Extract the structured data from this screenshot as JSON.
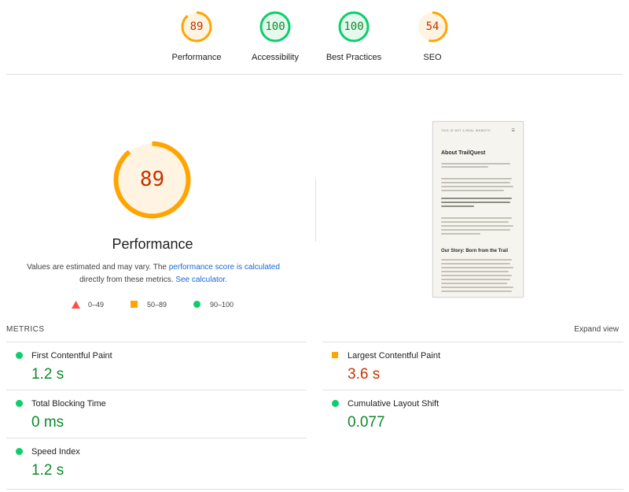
{
  "categories": [
    {
      "label": "Performance",
      "score": "89",
      "fraction": 0.89,
      "rating": "average"
    },
    {
      "label": "Accessibility",
      "score": "100",
      "fraction": 1.0,
      "rating": "pass"
    },
    {
      "label": "Best Practices",
      "score": "100",
      "fraction": 1.0,
      "rating": "pass"
    },
    {
      "label": "SEO",
      "score": "54",
      "fraction": 0.54,
      "rating": "average"
    }
  ],
  "performance": {
    "score": "89",
    "fraction": 0.89,
    "title": "Performance",
    "desc_prefix": "Values are estimated and may vary. The ",
    "desc_link": "performance score is calculated",
    "desc_mid": "directly from these metrics. ",
    "desc_link2": "See calculator."
  },
  "legend": [
    {
      "icon": "triangle-icon",
      "range": "0–49"
    },
    {
      "icon": "square-icon",
      "range": "50–89"
    },
    {
      "icon": "circle-icon",
      "range": "90–100"
    }
  ],
  "thumbnail": {
    "header": "THIS IS NOT A REAL WEBSITE",
    "menu": "☰",
    "heading": "About TrailQuest",
    "subheading": "Our Story: Born from the Trail"
  },
  "metrics": {
    "title": "METRICS",
    "expand": "Expand view",
    "items": [
      {
        "name": "First Contentful Paint",
        "value": "1.2 s",
        "rating": "pass"
      },
      {
        "name": "Largest Contentful Paint",
        "value": "3.6 s",
        "rating": "average"
      },
      {
        "name": "Total Blocking Time",
        "value": "0 ms",
        "rating": "pass"
      },
      {
        "name": "Cumulative Layout Shift",
        "value": "0.077",
        "rating": "pass"
      },
      {
        "name": "Speed Index",
        "value": "1.2 s",
        "rating": "pass"
      }
    ]
  },
  "colors": {
    "pass": "#0cce6b",
    "pass_text": "#0c8a2a",
    "pass_bg": "#e6f9ee",
    "average": "#ffa400",
    "average_text": "#c33300",
    "average_bg": "#fff4e2",
    "fail": "#ff4e42",
    "link": "#1967d2"
  }
}
